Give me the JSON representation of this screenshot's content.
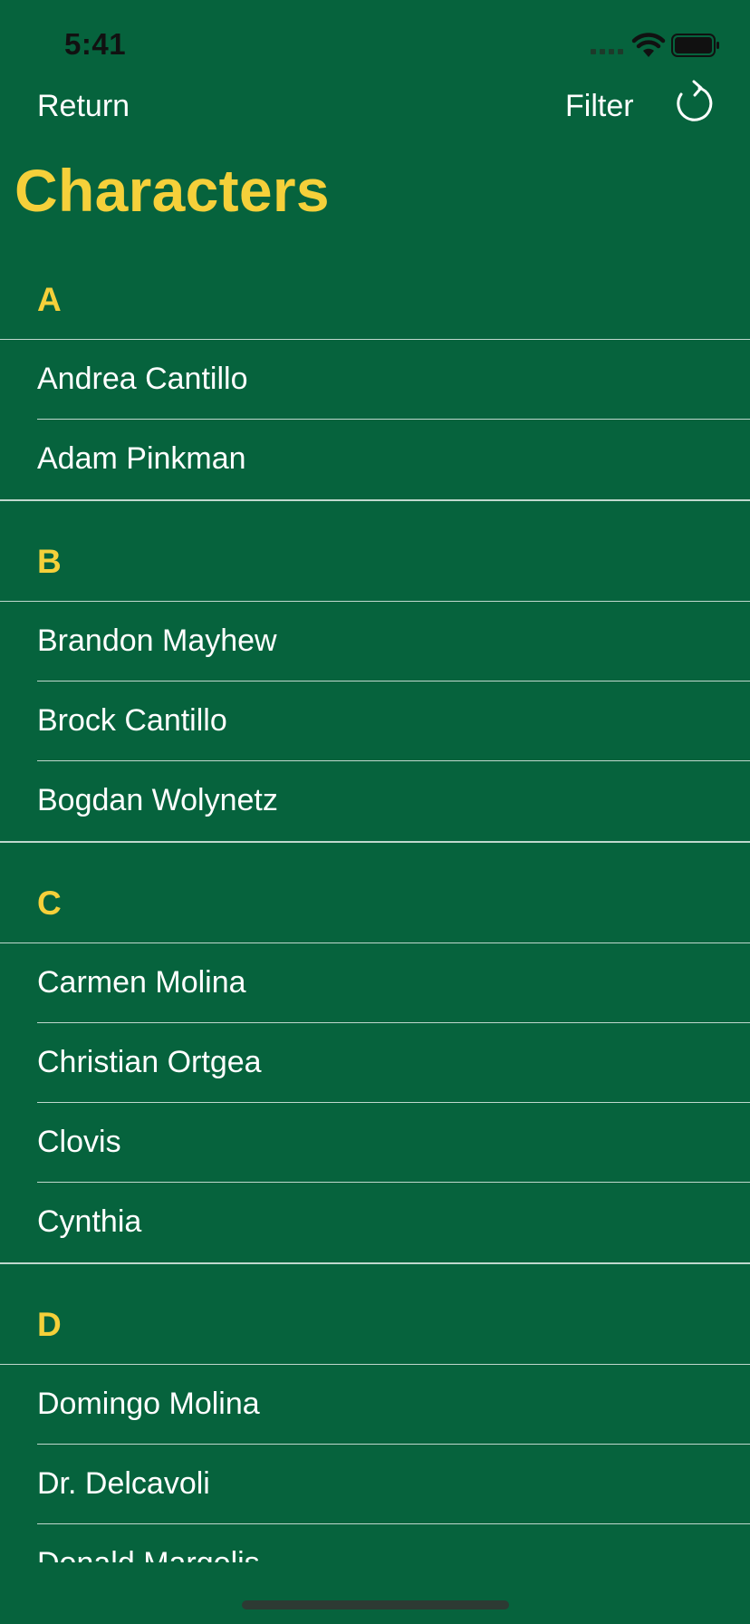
{
  "status_bar": {
    "time": "5:41"
  },
  "nav": {
    "return_label": "Return",
    "filter_label": "Filter",
    "refresh_icon": "refresh-icon"
  },
  "page": {
    "title": "Characters"
  },
  "colors": {
    "background": "#06633d",
    "accent": "#f5d03a",
    "text": "#ffffff"
  },
  "sections": [
    {
      "letter": "A",
      "items": [
        "Andrea Cantillo",
        "Adam Pinkman"
      ]
    },
    {
      "letter": "B",
      "items": [
        "Brandon Mayhew",
        "Brock Cantillo",
        "Bogdan Wolynetz"
      ]
    },
    {
      "letter": "C",
      "items": [
        "Carmen Molina",
        "Christian Ortgea",
        "Clovis",
        "Cynthia"
      ]
    },
    {
      "letter": "D",
      "items": [
        "Domingo Molina",
        "Dr. Delcavoli",
        "Donald Margolis"
      ]
    }
  ]
}
